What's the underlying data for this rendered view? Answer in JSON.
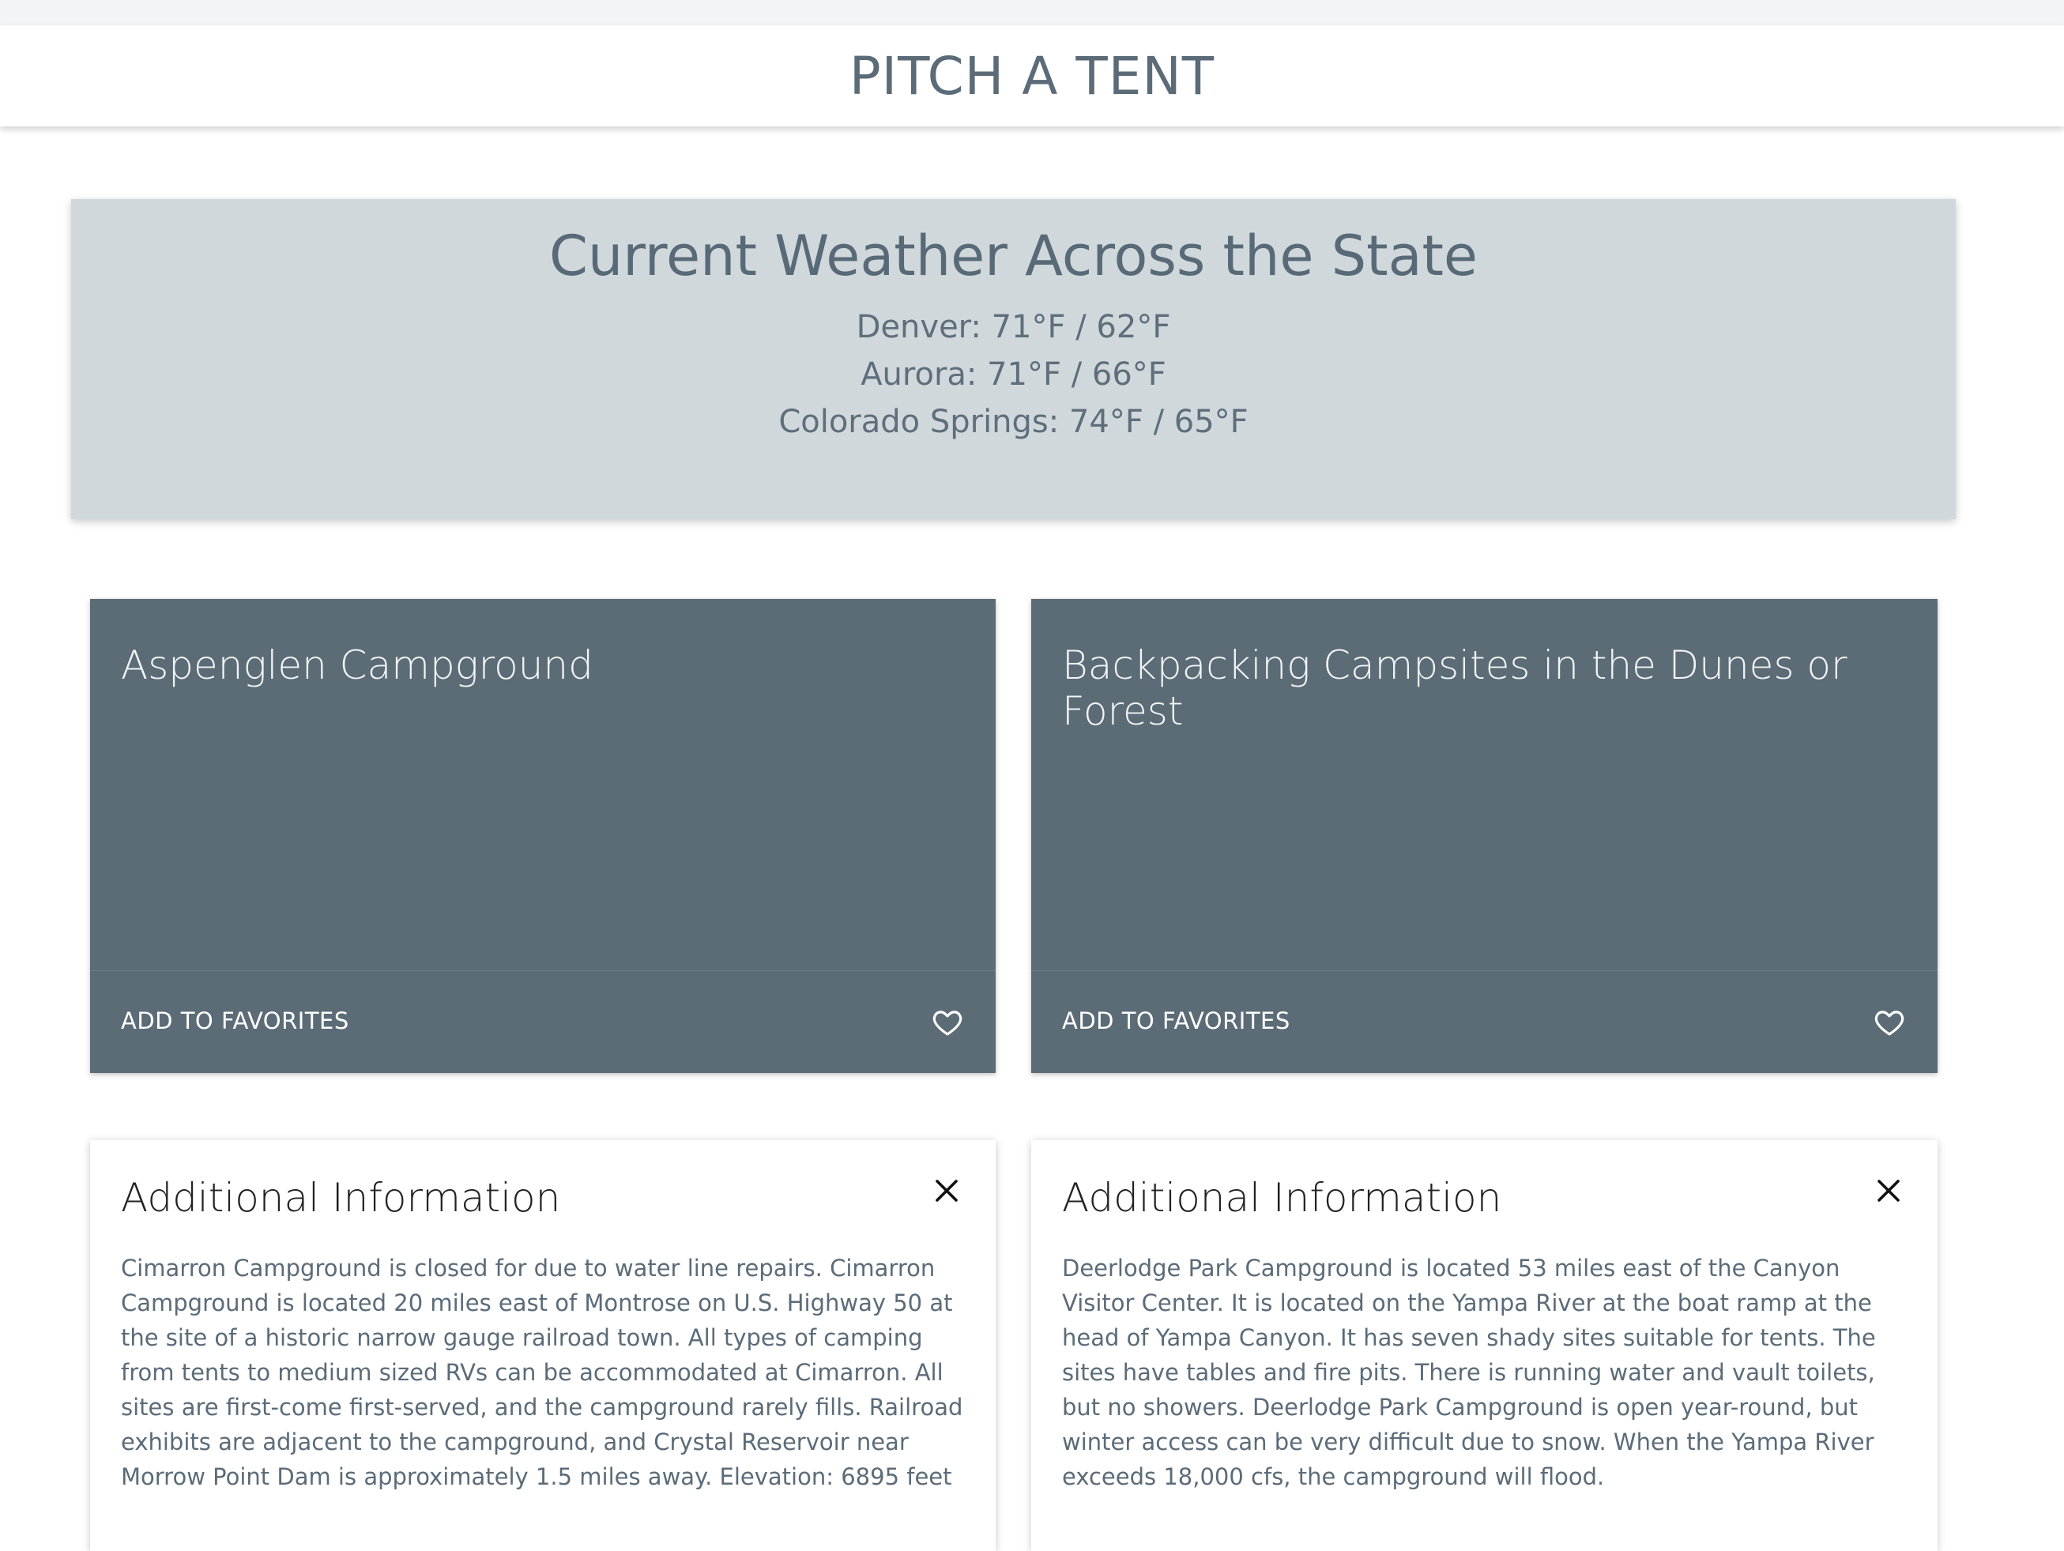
{
  "header": {
    "title": "PITCH A TENT"
  },
  "weather": {
    "heading": "Current Weather Across the State",
    "cities": [
      "Denver: 71°F / 62°F",
      "Aurora: 71°F / 66°F",
      "Colorado Springs: 74°F / 65°F"
    ]
  },
  "cards": [
    {
      "title": "Aspenglen Campground",
      "favorite_label": "ADD TO FAVORITES"
    },
    {
      "title": "Backpacking Campsites in the Dunes or Forest",
      "favorite_label": "ADD TO FAVORITES"
    }
  ],
  "info_panels": [
    {
      "heading": "Additional Information",
      "text": "Cimarron Campground is closed for due to water line repairs. Cimarron Campground is located 20 miles east of Montrose on U.S. Highway 50 at the site of a historic narrow gauge railroad town. All types of camping from tents to medium sized RVs can be accommodated at Cimarron. All sites are first-come first-served, and the campground rarely fills. Railroad exhibits are adjacent to the campground, and Crystal Reservoir near Morrow Point Dam is approximately 1.5 miles away. Elevation: 6895 feet"
    },
    {
      "heading": "Additional Information",
      "text": "Deerlodge Park Campground is located 53 miles east of the Canyon Visitor Center. It is located on the Yampa River at the boat ramp at the head of Yampa Canyon. It has seven shady sites suitable for tents. The sites have tables and fire pits. There is running water and vault toilets, but no showers. Deerlodge Park Campground is open year-round, but winter access can be very difficult due to snow. When the Yampa River exceeds 18,000 cfs, the campground will flood."
    }
  ],
  "icons": {
    "favorite": "heart-outline-icon",
    "close": "close-icon"
  },
  "colors": {
    "card_bg": "#5b6c77",
    "weather_bg": "#d0d8dc",
    "title_text": "#5b6b78"
  }
}
